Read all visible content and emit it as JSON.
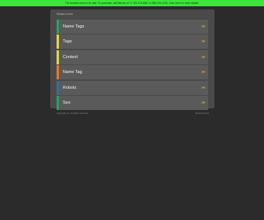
{
  "banner": {
    "text": "The domain name is for sale. To purchase, call Afternic at +1 781-373-6847 or 855-201-4761. Click here for more details."
  },
  "panel": {
    "header": "Related Links"
  },
  "links": [
    {
      "label": "Name Tags",
      "arrow": "»»",
      "color": "#2e9e6a"
    },
    {
      "label": "Tags",
      "arrow": "»»",
      "color": "#e6d64a"
    },
    {
      "label": "Content",
      "arrow": "»»",
      "color": "#d9d94a"
    },
    {
      "label": "Name Tag",
      "arrow": "»»",
      "color": "#e8772e"
    },
    {
      "label": "Robots",
      "arrow": "»»",
      "color": "#3a6f8f"
    },
    {
      "label": "Seo",
      "arrow": "»»",
      "color": "#2e9e6a"
    }
  ],
  "footer": {
    "copyright": "Copyright (c). All rights reserved.",
    "privacy": "Privacy Policy"
  }
}
